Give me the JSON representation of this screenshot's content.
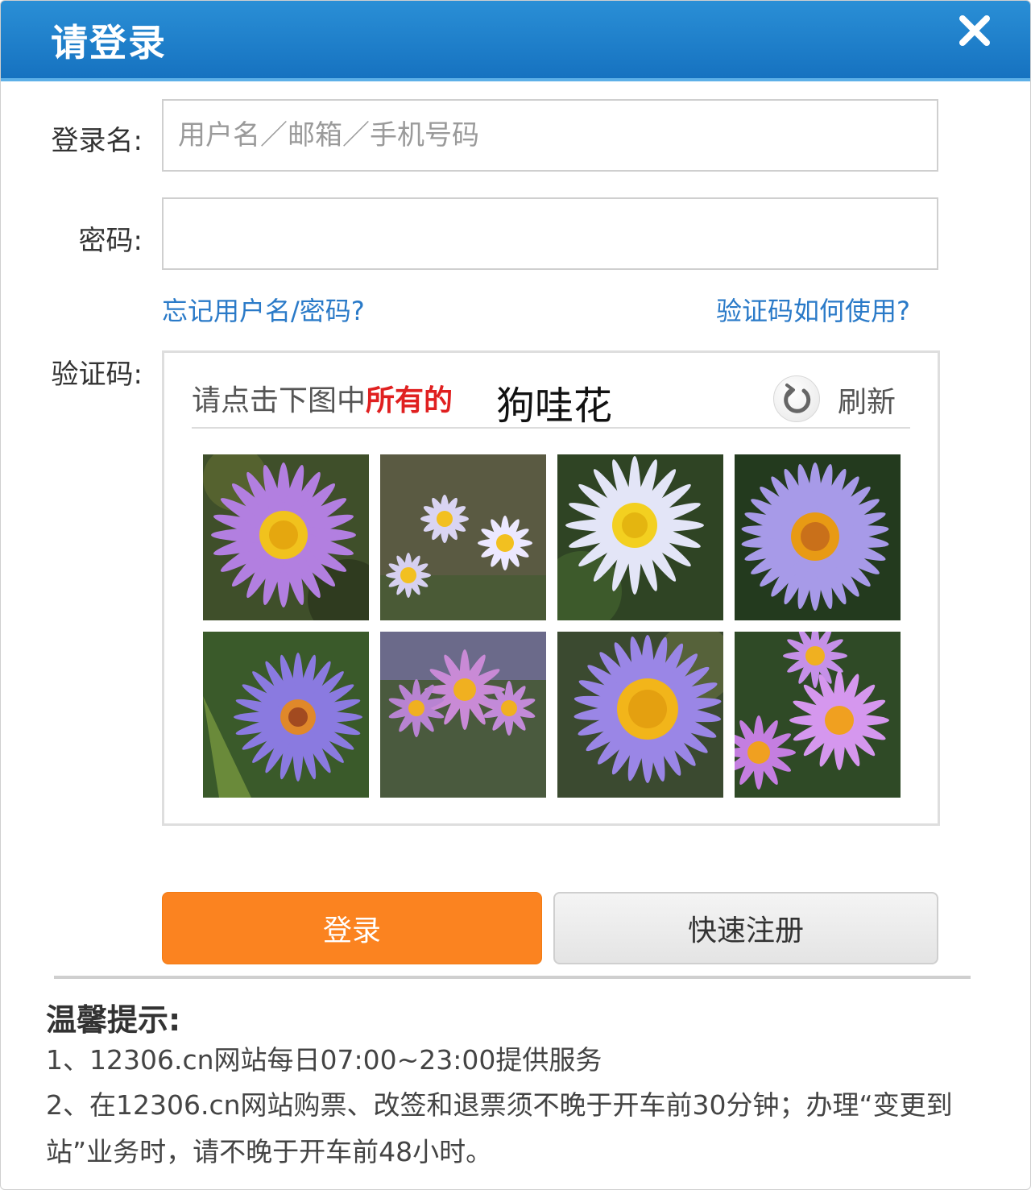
{
  "dialog": {
    "title": "请登录",
    "close_icon": "close-icon"
  },
  "form": {
    "username_label": "登录名:",
    "username_placeholder": "用户名／邮箱／手机号码",
    "username_value": "",
    "password_label": "密码:",
    "password_value": "",
    "forgot_link": "忘记用户名/密码?",
    "captcha_help_link": "验证码如何使用?",
    "captcha_label": "验证码:"
  },
  "captcha": {
    "prompt_prefix": "请点击下图中",
    "prompt_emphasis": "所有的",
    "prompt_target": "狗哇花",
    "refresh_label": "刷新",
    "refresh_icon": "refresh-icon",
    "tiles": [
      {
        "name": "purple-aster-photo"
      },
      {
        "name": "pale-asters-cluster-photo"
      },
      {
        "name": "white-aster-photo"
      },
      {
        "name": "lilac-aster-photo"
      },
      {
        "name": "violet-aster-photo"
      },
      {
        "name": "pink-aster-field-photo"
      },
      {
        "name": "lavender-aster-photo"
      },
      {
        "name": "pink-asters-group-photo"
      }
    ]
  },
  "actions": {
    "login_label": "登录",
    "register_label": "快速注册",
    "login_color": "#fb8320"
  },
  "tips": {
    "title": "温馨提示:",
    "line1": "1、12306.cn网站每日07:00~23:00提供服务",
    "line2": "2、在12306.cn网站购票、改签和退票须不晚于开车前30分钟；办理“变更到站”业务时，请不晚于开车前48小时。"
  },
  "colors": {
    "titlebar": "#1e80cc",
    "link": "#2a7ac8",
    "emphasis": "#e02020"
  }
}
